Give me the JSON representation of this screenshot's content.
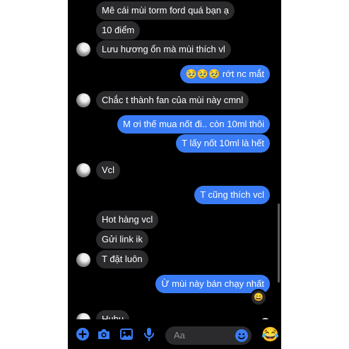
{
  "messages": [
    {
      "side": "in",
      "text": "Mê cái mùi torm ford quá bạn ạ"
    },
    {
      "side": "in",
      "text": "10 điểm"
    },
    {
      "side": "in",
      "text": "Lưu hương ổn mà mùi thích vl"
    },
    {
      "side": "out",
      "text": "🥹🥹🥹 rớt nc mắt"
    },
    {
      "side": "in",
      "text": "Chắc t thành fan của mùi này cmnl"
    },
    {
      "side": "out",
      "text": "M ơi thế mua nốt đi.. còn 10ml thôi"
    },
    {
      "side": "out",
      "text": "T lấy nốt 10ml là hết"
    },
    {
      "side": "in",
      "text": "Vcl"
    },
    {
      "side": "out",
      "text": "T cũng thích vcl"
    },
    {
      "side": "in",
      "text": "Hot hàng vcl"
    },
    {
      "side": "in",
      "text": "Gửi link ik"
    },
    {
      "side": "in",
      "text": "T đặt luôn"
    },
    {
      "side": "out",
      "text": "Ừ mùi này bán chạy nhất"
    },
    {
      "side": "in",
      "text": "Huhu"
    }
  ],
  "reaction": "😄",
  "composer": {
    "placeholder": "Aa",
    "like_emoji": "😂",
    "icons": [
      "plus-icon",
      "camera-icon",
      "gallery-icon",
      "microphone-icon",
      "emoji-icon"
    ]
  },
  "colors": {
    "accent": "#3a7cf5",
    "incoming_bubble": "#2b2b2d",
    "background": "#000000"
  }
}
